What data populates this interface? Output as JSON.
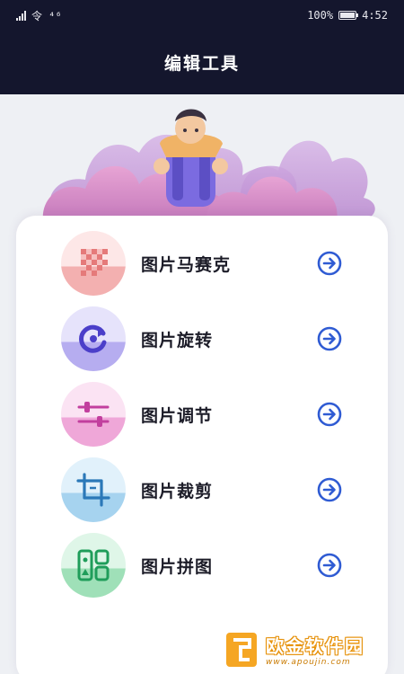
{
  "status_bar": {
    "left_text": "令 ⁴⁶",
    "battery_percent": "100%",
    "time": "4:52"
  },
  "header": {
    "title": "编辑工具"
  },
  "menu": {
    "items": [
      {
        "label": "图片马赛克",
        "icon": "mosaic-icon"
      },
      {
        "label": "图片旋转",
        "icon": "rotate-icon"
      },
      {
        "label": "图片调节",
        "icon": "adjust-sliders-icon"
      },
      {
        "label": "图片裁剪",
        "icon": "crop-icon"
      },
      {
        "label": "图片拼图",
        "icon": "collage-icon"
      }
    ],
    "arrow_icon": "arrow-right-circle-icon"
  },
  "watermark": {
    "name": "欧金软件园",
    "url": "www.apoujin.com"
  },
  "colors": {
    "header_bg": "#14162d",
    "page_bg": "#eef0f4",
    "arrow": "#2f5bd3"
  }
}
